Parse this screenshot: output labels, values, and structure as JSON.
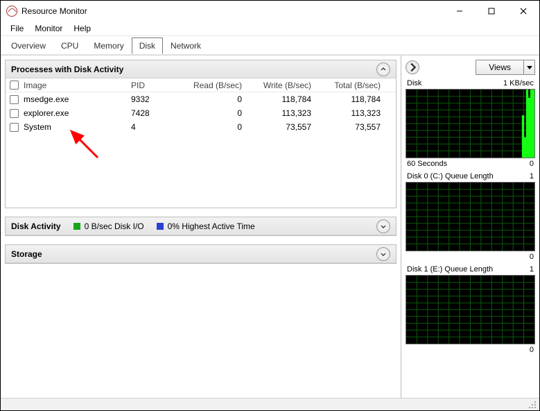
{
  "window": {
    "title": "Resource Monitor"
  },
  "menu": {
    "file": "File",
    "monitor": "Monitor",
    "help": "Help"
  },
  "tabs": {
    "overview": "Overview",
    "cpu": "CPU",
    "memory": "Memory",
    "disk": "Disk",
    "network": "Network"
  },
  "processes_panel": {
    "title": "Processes with Disk Activity",
    "columns": {
      "image": "Image",
      "pid": "PID",
      "read": "Read (B/sec)",
      "write": "Write (B/sec)",
      "total": "Total (B/sec)"
    },
    "rows": [
      {
        "image": "msedge.exe",
        "pid": "9332",
        "read": "0",
        "write": "118,784",
        "total": "118,784"
      },
      {
        "image": "explorer.exe",
        "pid": "7428",
        "read": "0",
        "write": "113,323",
        "total": "113,323"
      },
      {
        "image": "System",
        "pid": "4",
        "read": "0",
        "write": "73,557",
        "total": "73,557"
      }
    ]
  },
  "disk_activity_panel": {
    "title": "Disk Activity",
    "io_legend": "0 B/sec Disk I/O",
    "active_legend": "0% Highest Active Time",
    "io_color": "#17a51a",
    "active_color": "#2b3fd1"
  },
  "storage_panel": {
    "title": "Storage"
  },
  "right": {
    "views_label": "Views",
    "graphs": [
      {
        "title_left": "Disk",
        "title_right": "1 KB/sec",
        "bottom_left": "60 Seconds",
        "bottom_right": "0",
        "bars": true
      },
      {
        "title_left": "Disk 0 (C:) Queue Length",
        "title_right": "1",
        "bottom_left": "",
        "bottom_right": "0",
        "bars": false
      },
      {
        "title_left": "Disk 1 (E:) Queue Length",
        "title_right": "1",
        "bottom_left": "",
        "bottom_right": "0",
        "bars": false
      }
    ]
  }
}
